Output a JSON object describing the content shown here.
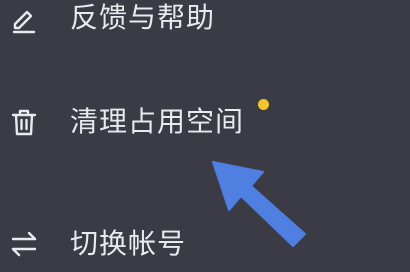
{
  "menu": {
    "items": [
      {
        "label": "反馈与帮助",
        "icon": "edit-icon"
      },
      {
        "label": "清理占用空间",
        "icon": "trash-icon",
        "badge": "new-dot"
      },
      {
        "label": "切换帐号",
        "icon": "switch-arrows-icon"
      }
    ]
  },
  "annotation": {
    "pointer": "arrow-pointer-icon",
    "pointer_color": "#4f7fe0"
  },
  "colors": {
    "background": "#3a3b45",
    "text": "#e9e9ee",
    "badge": "#f2c531"
  }
}
